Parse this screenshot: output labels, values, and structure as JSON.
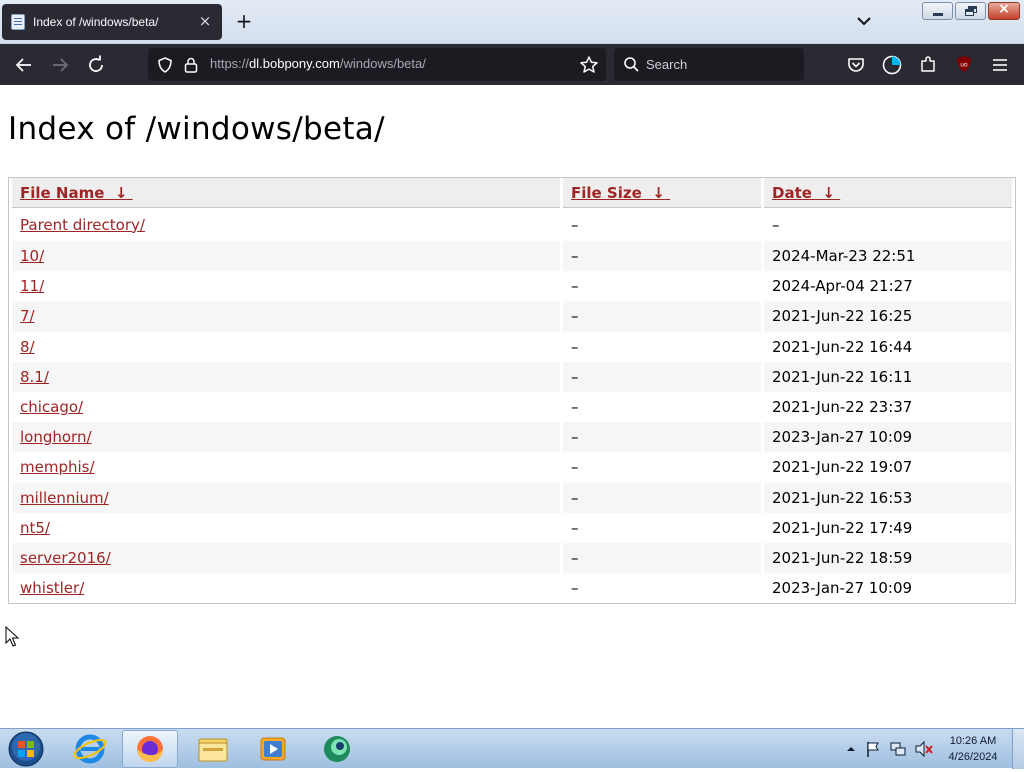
{
  "browser": {
    "tab": {
      "title": "Index of /windows/beta/",
      "close_glyph": "×"
    },
    "new_tab_glyph": "+",
    "url": {
      "scheme": "https://",
      "host": "dl.bobpony.com",
      "path": "/windows/beta/"
    },
    "search_placeholder": "Search",
    "colors": {
      "chrome": "#2b2a33",
      "field": "#1c1b22",
      "link": "#a02525"
    }
  },
  "page": {
    "title": "Index of /windows/beta/",
    "columns": [
      {
        "label": "File Name",
        "sort_glyph": "↓"
      },
      {
        "label": "File Size",
        "sort_glyph": "↓"
      },
      {
        "label": "Date",
        "sort_glyph": "↓"
      }
    ],
    "rows": [
      {
        "name": "Parent directory/",
        "size": "–",
        "date": "–"
      },
      {
        "name": "10/",
        "size": "–",
        "date": "2024-Mar-23 22:51"
      },
      {
        "name": "11/",
        "size": "–",
        "date": "2024-Apr-04 21:27"
      },
      {
        "name": "7/",
        "size": "–",
        "date": "2021-Jun-22 16:25"
      },
      {
        "name": "8/",
        "size": "–",
        "date": "2021-Jun-22 16:44"
      },
      {
        "name": "8.1/",
        "size": "–",
        "date": "2021-Jun-22 16:11"
      },
      {
        "name": "chicago/",
        "size": "–",
        "date": "2021-Jun-22 23:37"
      },
      {
        "name": "longhorn/",
        "size": "–",
        "date": "2023-Jan-27 10:09"
      },
      {
        "name": "memphis/",
        "size": "–",
        "date": "2021-Jun-22 19:07"
      },
      {
        "name": "millennium/",
        "size": "–",
        "date": "2021-Jun-22 16:53"
      },
      {
        "name": "nt5/",
        "size": "–",
        "date": "2021-Jun-22 17:49"
      },
      {
        "name": "server2016/",
        "size": "–",
        "date": "2021-Jun-22 18:59"
      },
      {
        "name": "whistler/",
        "size": "–",
        "date": "2023-Jan-27 10:09"
      }
    ]
  },
  "taskbar": {
    "clock": {
      "time": "10:26 AM",
      "date": "4/26/2024"
    },
    "pinned": [
      "start-orb-icon",
      "internet-explorer-icon",
      "firefox-icon",
      "file-explorer-icon",
      "media-player-icon",
      "app-icon"
    ]
  }
}
